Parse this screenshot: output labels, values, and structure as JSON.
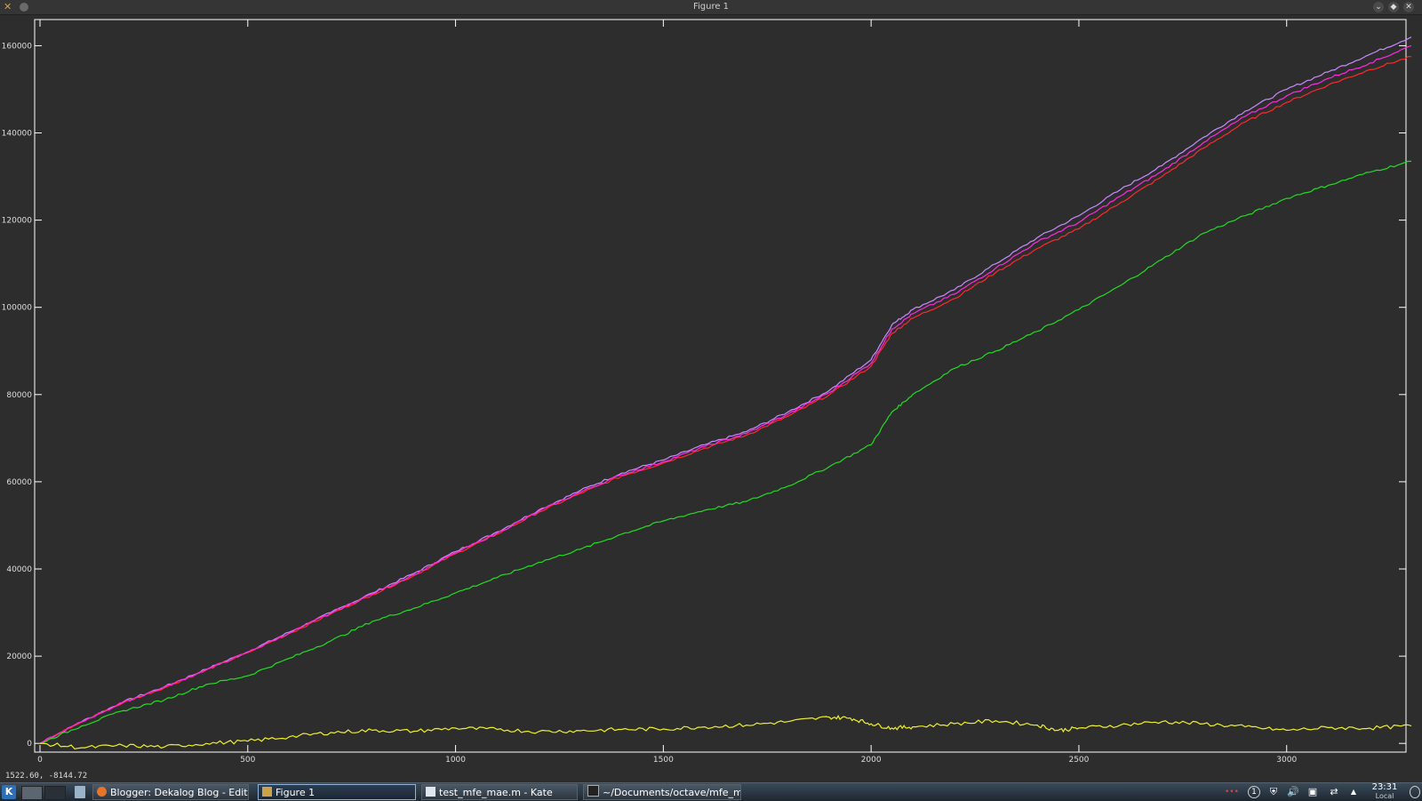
{
  "window": {
    "title": "Figure 1"
  },
  "status": {
    "coords": "1522.60, -8144.72"
  },
  "taskbar": {
    "tasks": [
      {
        "label": "Blogger: Dekalog Blog - Edit p"
      },
      {
        "label": "Figure 1"
      },
      {
        "label": "test_mfe_mae.m - Kate"
      },
      {
        "label": "~/Documents/octave/mfe_ma"
      }
    ],
    "clock": "23:31",
    "zone": "Local"
  },
  "icons": {
    "app": "octave-figure-icon",
    "k_menu": "kde-menu-icon",
    "firefox": "firefox-icon",
    "kate": "kate-icon",
    "terminal": "terminal-icon"
  },
  "colors": {
    "background": "#2d2d2d",
    "axes": "#ffffff",
    "series_violet": "#c78cff",
    "series_red": "#ff2a2a",
    "series_magenta": "#ff2adf",
    "series_green": "#22dd22",
    "series_yellow": "#f0f02a"
  },
  "chart_data": {
    "type": "line",
    "title": "",
    "xlabel": "",
    "ylabel": "",
    "xlim": [
      0,
      3300
    ],
    "ylim": [
      -2000,
      166000
    ],
    "xticks": [
      0,
      500,
      1000,
      1500,
      2000,
      2500,
      3000
    ],
    "yticks": [
      0,
      20000,
      40000,
      60000,
      80000,
      100000,
      120000,
      140000,
      160000
    ],
    "grid": false,
    "legend": "none",
    "series": [
      {
        "color": "#c78cff",
        "x": [
          0,
          100,
          200,
          300,
          400,
          500,
          600,
          700,
          800,
          900,
          1000,
          1100,
          1200,
          1300,
          1400,
          1500,
          1600,
          1700,
          1800,
          1900,
          2000,
          2050,
          2100,
          2200,
          2300,
          2400,
          2500,
          2600,
          2700,
          2800,
          2900,
          3000,
          3100,
          3200,
          3300
        ],
        "y": [
          0,
          5000,
          9500,
          13000,
          17000,
          21000,
          25500,
          30000,
          34500,
          39000,
          44000,
          48500,
          53500,
          58000,
          62000,
          65000,
          68500,
          71500,
          76000,
          81000,
          88000,
          96000,
          99500,
          104000,
          110000,
          116000,
          121000,
          127000,
          132500,
          139000,
          145000,
          150000,
          154000,
          158000,
          162000
        ]
      },
      {
        "color": "#ff2a2a",
        "x": [
          0,
          100,
          200,
          300,
          400,
          500,
          600,
          700,
          800,
          900,
          1000,
          1100,
          1200,
          1300,
          1400,
          1500,
          1600,
          1700,
          1800,
          1900,
          2000,
          2050,
          2100,
          2200,
          2300,
          2400,
          2500,
          2600,
          2700,
          2800,
          2900,
          3000,
          3100,
          3200,
          3300
        ],
        "y": [
          0,
          4900,
          9300,
          12800,
          16800,
          20800,
          25200,
          29700,
          34100,
          38500,
          43500,
          48000,
          53000,
          57300,
          61300,
          64300,
          67700,
          70700,
          75000,
          80000,
          86500,
          94000,
          97500,
          102000,
          108000,
          113500,
          118000,
          124000,
          130000,
          136500,
          142500,
          147000,
          151000,
          154500,
          157500
        ]
      },
      {
        "color": "#ff2adf",
        "x": [
          0,
          100,
          200,
          300,
          400,
          500,
          600,
          700,
          800,
          900,
          1000,
          1100,
          1200,
          1300,
          1400,
          1500,
          1600,
          1700,
          1800,
          1900,
          2000,
          2050,
          2100,
          2200,
          2300,
          2400,
          2500,
          2600,
          2700,
          2800,
          2900,
          3000,
          3100,
          3200,
          3300
        ],
        "y": [
          0,
          4950,
          9400,
          12900,
          16900,
          20900,
          25350,
          29850,
          34300,
          38700,
          43700,
          48200,
          53200,
          57600,
          61600,
          64600,
          68100,
          71100,
          75500,
          80500,
          87200,
          95000,
          98500,
          103000,
          109000,
          115000,
          119500,
          125500,
          131200,
          137800,
          143800,
          148500,
          152500,
          156000,
          160000
        ]
      },
      {
        "color": "#22dd22",
        "x": [
          0,
          100,
          200,
          300,
          400,
          500,
          600,
          700,
          800,
          900,
          1000,
          1100,
          1200,
          1300,
          1400,
          1500,
          1600,
          1700,
          1800,
          1900,
          2000,
          2050,
          2100,
          2200,
          2300,
          2400,
          2500,
          2600,
          2700,
          2800,
          2900,
          3000,
          3100,
          3200,
          3300
        ],
        "y": [
          0,
          4000,
          7500,
          10000,
          13500,
          15500,
          19500,
          23500,
          28000,
          31000,
          34500,
          38000,
          41500,
          44500,
          48000,
          51000,
          53500,
          55500,
          59000,
          63500,
          68500,
          76000,
          80000,
          86000,
          90000,
          94500,
          99500,
          105000,
          111000,
          117000,
          121000,
          125000,
          128000,
          131000,
          133500
        ]
      },
      {
        "color": "#f0f02a",
        "x": [
          0,
          100,
          200,
          300,
          400,
          500,
          600,
          700,
          800,
          900,
          1000,
          1100,
          1200,
          1300,
          1400,
          1500,
          1600,
          1700,
          1800,
          1900,
          1950,
          2000,
          2050,
          2100,
          2200,
          2300,
          2400,
          2450,
          2500,
          2600,
          2700,
          2800,
          2900,
          3000,
          3100,
          3200,
          3300
        ],
        "y": [
          0,
          -1000,
          -500,
          -800,
          0,
          500,
          1500,
          2500,
          3000,
          2800,
          3500,
          3200,
          2700,
          2900,
          3200,
          3300,
          3800,
          4200,
          5000,
          6000,
          5800,
          4500,
          3500,
          3800,
          4500,
          5200,
          4200,
          3000,
          3500,
          4200,
          5000,
          4500,
          3800,
          3000,
          3600,
          3500,
          4000
        ]
      }
    ]
  }
}
